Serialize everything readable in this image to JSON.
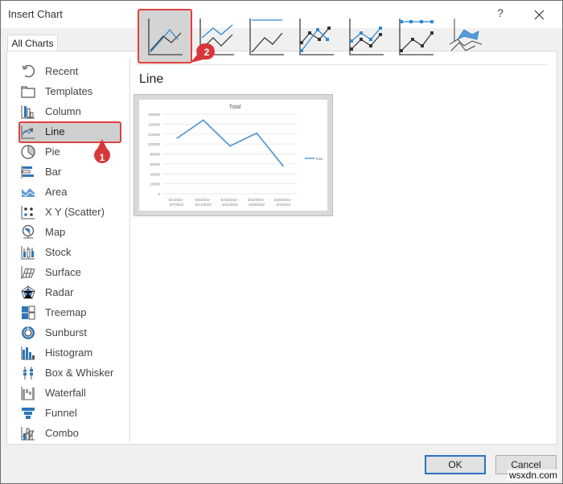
{
  "window": {
    "title": "Insert Chart",
    "help_label": "?",
    "close_label": "close"
  },
  "tabs": [
    {
      "label": "All Charts",
      "active": true
    }
  ],
  "sidebar": {
    "selected": "Line",
    "items": [
      {
        "label": "Recent",
        "icon": "recent-icon"
      },
      {
        "label": "Templates",
        "icon": "templates-folder-icon"
      },
      {
        "label": "Column",
        "icon": "column-chart-icon"
      },
      {
        "label": "Line",
        "icon": "line-chart-icon"
      },
      {
        "label": "Pie",
        "icon": "pie-chart-icon"
      },
      {
        "label": "Bar",
        "icon": "bar-chart-icon"
      },
      {
        "label": "Area",
        "icon": "area-chart-icon"
      },
      {
        "label": "X Y (Scatter)",
        "icon": "scatter-chart-icon"
      },
      {
        "label": "Map",
        "icon": "map-globe-icon"
      },
      {
        "label": "Stock",
        "icon": "stock-chart-icon"
      },
      {
        "label": "Surface",
        "icon": "surface-chart-icon"
      },
      {
        "label": "Radar",
        "icon": "radar-chart-icon"
      },
      {
        "label": "Treemap",
        "icon": "treemap-chart-icon"
      },
      {
        "label": "Sunburst",
        "icon": "sunburst-chart-icon"
      },
      {
        "label": "Histogram",
        "icon": "histogram-chart-icon"
      },
      {
        "label": "Box & Whisker",
        "icon": "box-whisker-chart-icon"
      },
      {
        "label": "Waterfall",
        "icon": "waterfall-chart-icon"
      },
      {
        "label": "Funnel",
        "icon": "funnel-chart-icon"
      },
      {
        "label": "Combo",
        "icon": "combo-chart-icon"
      }
    ]
  },
  "subtypes": {
    "selected_index": 0,
    "items": [
      {
        "name": "line"
      },
      {
        "name": "stacked-line"
      },
      {
        "name": "100-stacked-line"
      },
      {
        "name": "line-with-markers"
      },
      {
        "name": "stacked-line-with-markers"
      },
      {
        "name": "100-stacked-line-with-markers"
      },
      {
        "name": "3d-line"
      }
    ]
  },
  "section_title": "Line",
  "annotations": [
    {
      "number": "1",
      "target": "Line category"
    },
    {
      "number": "2",
      "target": "Line subtype"
    }
  ],
  "colors": {
    "accent": "#e0403f",
    "series": "#5b9bd5",
    "ok_border": "#2b73c5"
  },
  "chart_data": {
    "type": "line",
    "title": "Total",
    "categories": [
      "5/1/2022 - 5/7/2022",
      "5/8/2022 - 5/14/2022",
      "5/15/2022 - 5/21/2022",
      "5/22/2022 - 5/28/2022",
      "5/29/2022 - 6/1/2022"
    ],
    "series": [
      {
        "name": "Total",
        "values": [
          111000,
          148000,
          96000,
          122000,
          55000
        ]
      }
    ],
    "y_ticks": [
      "0",
      "20000",
      "40000",
      "60000",
      "80000",
      "100000",
      "120000",
      "140000",
      "160000"
    ],
    "ylim": [
      0,
      160000
    ],
    "grid": true,
    "legend": "right",
    "xlabel": "",
    "ylabel": ""
  },
  "buttons": {
    "ok": "OK",
    "cancel": "Cancel"
  },
  "watermark": "wsxdn.com"
}
